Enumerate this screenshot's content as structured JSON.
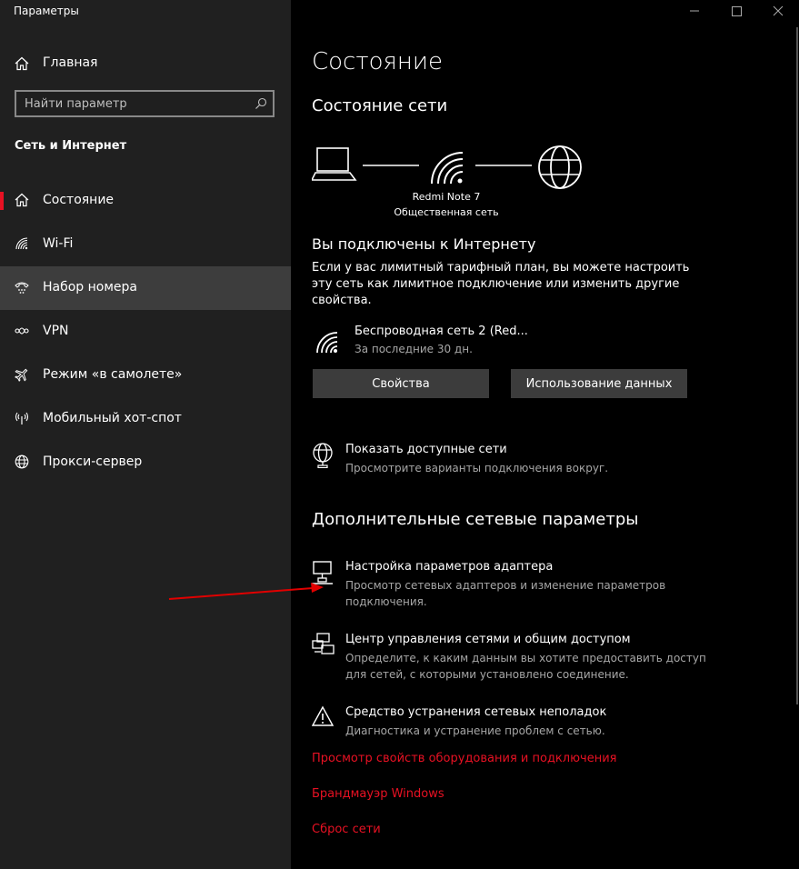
{
  "window": {
    "title": "Параметры"
  },
  "sidebar": {
    "home_label": "Главная",
    "search_placeholder": "Найти параметр",
    "section_title": "Сеть и Интернет",
    "items": [
      {
        "label": "Состояние",
        "icon": "home-icon",
        "selected": true
      },
      {
        "label": "Wi-Fi",
        "icon": "wifi-icon"
      },
      {
        "label": "Набор номера",
        "icon": "dialup-icon",
        "hovered": true
      },
      {
        "label": "VPN",
        "icon": "vpn-icon"
      },
      {
        "label": "Режим «в самолете»",
        "icon": "airplane-icon"
      },
      {
        "label": "Мобильный хот-спот",
        "icon": "hotspot-icon"
      },
      {
        "label": "Прокси-сервер",
        "icon": "globe-icon"
      }
    ]
  },
  "main": {
    "title": "Состояние",
    "network_status_title": "Состояние сети",
    "diagram": {
      "device_name": "Redmi Note 7",
      "network_type": "Общественная сеть"
    },
    "connected_title": "Вы подключены к Интернету",
    "connected_text": "Если у вас лимитный тарифный план, вы можете настроить эту сеть как лимитное подключение или изменить другие свойства.",
    "connection": {
      "name": "Беспроводная сеть 2 (Red...",
      "sub": "За последние 30 дн."
    },
    "buttons": {
      "properties": "Свойства",
      "data_usage": "Использование данных"
    },
    "show_networks": {
      "title": "Показать доступные сети",
      "desc": "Просмотрите варианты подключения вокруг."
    },
    "advanced_title": "Дополнительные сетевые параметры",
    "advanced_items": [
      {
        "title": "Настройка параметров адаптера",
        "desc": "Просмотр сетевых адаптеров и изменение параметров подключения."
      },
      {
        "title": "Центр управления сетями и общим доступом",
        "desc": "Определите, к каким данным вы хотите предоставить доступ для сетей, с которыми установлено соединение."
      },
      {
        "title": "Средство устранения сетевых неполадок",
        "desc": "Диагностика и устранение проблем с сетью."
      }
    ],
    "links": [
      "Просмотр свойств оборудования и подключения",
      "Брандмауэр Windows",
      "Сброс сети"
    ]
  },
  "colors": {
    "accent": "#e81123",
    "sidebar_bg": "#202020",
    "main_bg": "#000000",
    "annotation_arrow": "#e00000"
  }
}
